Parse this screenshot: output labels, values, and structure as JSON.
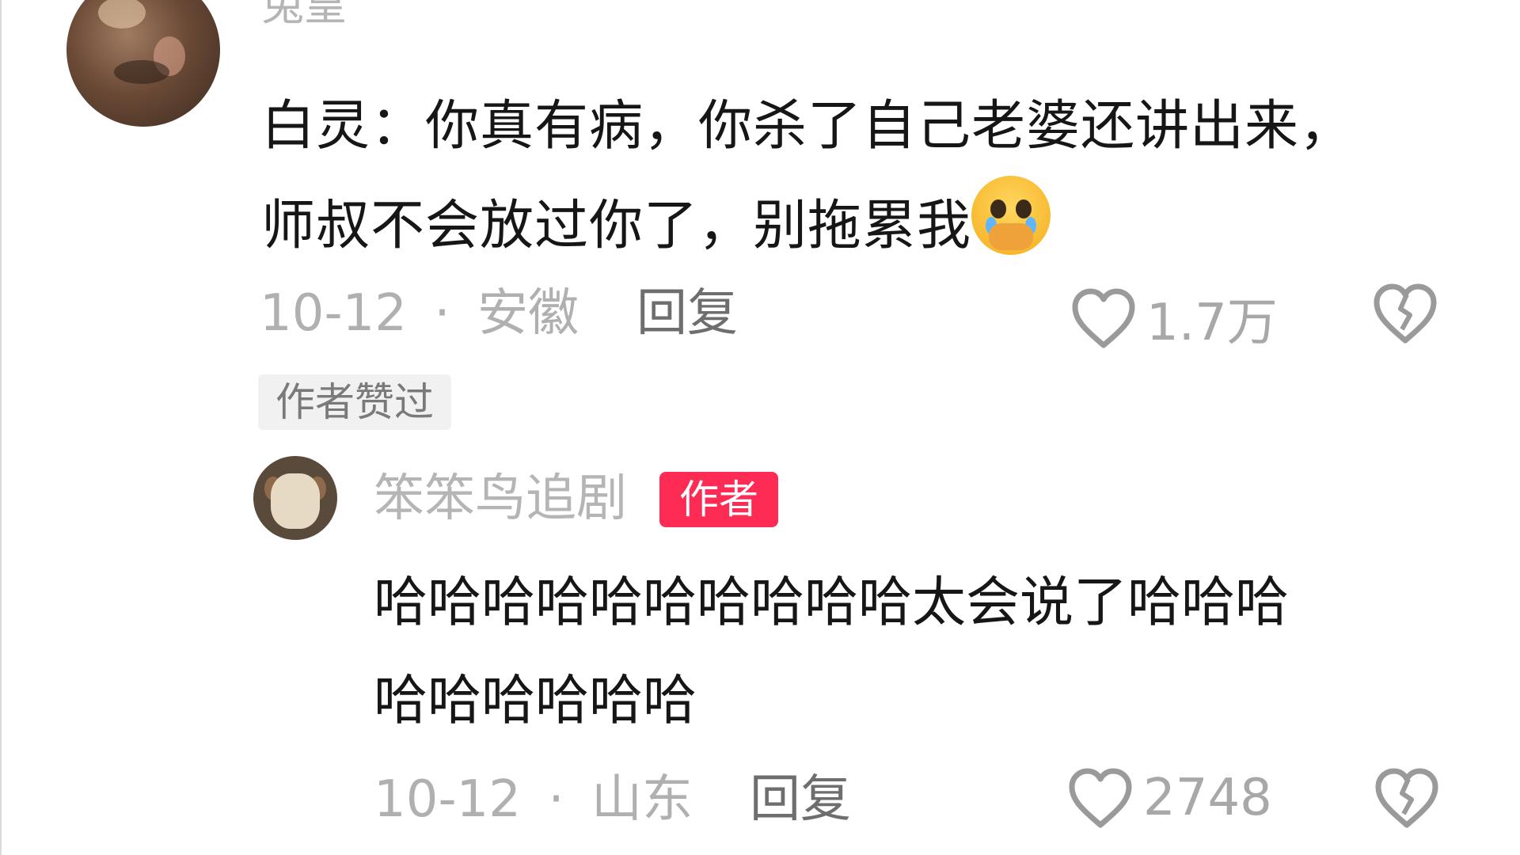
{
  "comments": [
    {
      "username": "兔皇",
      "text_line1": "白灵：你真有病，你杀了自己老婆还讲出来，",
      "text_line2": "师叔不会放过你了，别拖累我",
      "emoji": "pleading-face-crying-emoji",
      "date": "10-12",
      "separator": "·",
      "location": "安徽",
      "reply_label": "回复",
      "like_count": "1.7万",
      "author_liked_label": "作者赞过"
    }
  ],
  "reply": {
    "username": "笨笨鸟追剧",
    "author_badge": "作者",
    "text_line1": "哈哈哈哈哈哈哈哈哈哈太会说了哈哈哈",
    "text_line2": "哈哈哈哈哈哈",
    "date": "10-12",
    "separator": "·",
    "location": "山东",
    "reply_label": "回复",
    "like_count": "2748"
  },
  "icons": {
    "like": "heart-outline-icon",
    "dislike": "broken-heart-icon"
  },
  "colors": {
    "author_badge": "#fe2c55",
    "meta_text": "#b0b0b0",
    "body_text": "#161616"
  }
}
